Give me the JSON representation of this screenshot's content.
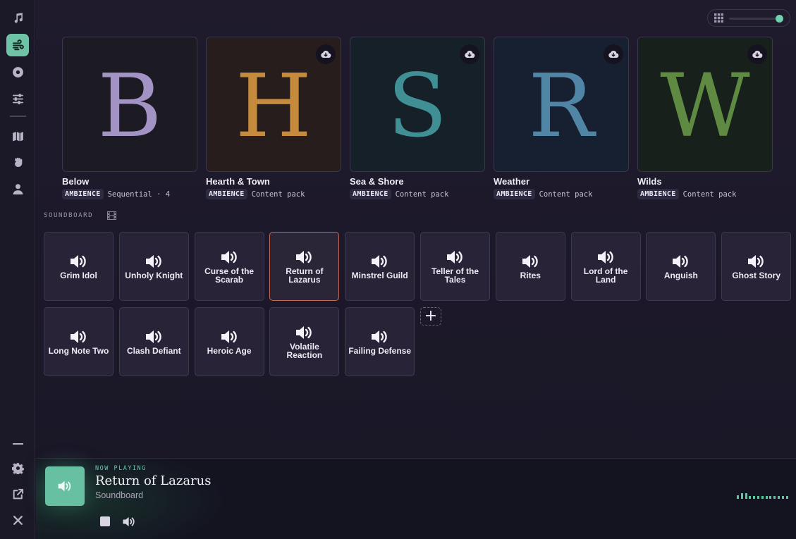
{
  "sidebar": {
    "items": [
      {
        "name": "music-icon",
        "active": false
      },
      {
        "name": "ambience-icon",
        "active": true
      },
      {
        "name": "disc-icon",
        "active": false
      },
      {
        "name": "sliders-icon",
        "active": false
      },
      {
        "name": "map-icon",
        "active": false
      },
      {
        "name": "fist-icon",
        "active": false
      },
      {
        "name": "user-icon",
        "active": false
      }
    ],
    "bottom": [
      "minimize-icon",
      "gear-icon",
      "external-link-icon",
      "close-icon"
    ]
  },
  "zoom": {
    "level": 1.0
  },
  "packs": [
    {
      "letter": "B",
      "name": "Below",
      "tag": "AMBIENCE",
      "sub": "Sequential · 4",
      "color": "#a393c4",
      "bg": "#1c1a22",
      "download": false
    },
    {
      "letter": "H",
      "name": "Hearth & Town",
      "tag": "AMBIENCE",
      "sub": "Content pack",
      "color": "#c58a3c",
      "bg": "#261d1c",
      "download": true
    },
    {
      "letter": "S",
      "name": "Sea & Shore",
      "tag": "AMBIENCE",
      "sub": "Content pack",
      "color": "#3f8f95",
      "bg": "#162028",
      "download": true
    },
    {
      "letter": "R",
      "name": "Weather",
      "tag": "AMBIENCE",
      "sub": "Content pack",
      "color": "#5185a6",
      "bg": "#172030",
      "download": true
    },
    {
      "letter": "W",
      "name": "Wilds",
      "tag": "AMBIENCE",
      "sub": "Content pack",
      "color": "#5f8a42",
      "bg": "#17201a",
      "download": true
    }
  ],
  "soundboard": {
    "label": "SOUNDBOARD",
    "tiles": [
      {
        "label": "Grim Idol",
        "playing": false
      },
      {
        "label": "Unholy Knight",
        "playing": false
      },
      {
        "label": "Curse of the Scarab",
        "playing": false
      },
      {
        "label": "Return of Lazarus",
        "playing": true
      },
      {
        "label": "Minstrel Guild",
        "playing": false
      },
      {
        "label": "Teller of the Tales",
        "playing": false
      },
      {
        "label": "Rites",
        "playing": false
      },
      {
        "label": "Lord of the Land",
        "playing": false
      },
      {
        "label": "Anguish",
        "playing": false
      },
      {
        "label": "Ghost Story",
        "playing": false
      },
      {
        "label": "Long Note Two",
        "playing": false
      },
      {
        "label": "Clash Defiant",
        "playing": false
      },
      {
        "label": "Heroic Age",
        "playing": false
      },
      {
        "label": "Volatile Reaction",
        "playing": false
      },
      {
        "label": "Failing Defense",
        "playing": false
      }
    ],
    "add_label": "+"
  },
  "player": {
    "now_playing_label": "NOW PLAYING",
    "title": "Return of Lazarus",
    "source": "Soundboard",
    "meter_levels": [
      0.5,
      0.8,
      0.8,
      0.4,
      0.4,
      0.4,
      0.4,
      0.4,
      0.4,
      0.4,
      0.4,
      0.4,
      0.4
    ]
  }
}
